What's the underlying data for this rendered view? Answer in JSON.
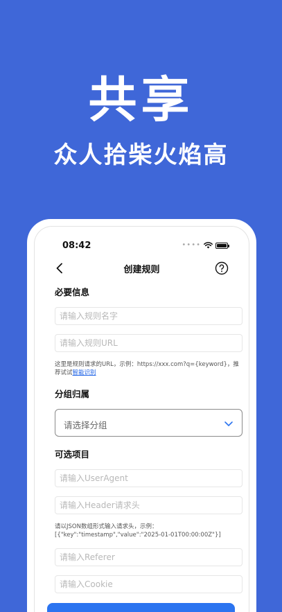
{
  "hero": {
    "title": "共享",
    "subtitle": "众人拾柴火焰高"
  },
  "status_bar": {
    "time": "08:42"
  },
  "nav": {
    "title": "创建规则",
    "back_icon": "chevron-left-icon",
    "help_icon": "question-circle-icon"
  },
  "required_section": {
    "title": "必要信息",
    "name_placeholder": "请输入规则名字",
    "url_placeholder": "请输入规则URL",
    "hint_text": "这里是规则请求的URL，示例：https://xxx.com?q={keyword}，推荐试试",
    "hint_link": "智能识别"
  },
  "group_section": {
    "title": "分组归属",
    "select_placeholder": "请选择分组"
  },
  "optional_section": {
    "title": "可选项目",
    "useragent_placeholder": "请输入UserAgent",
    "header_placeholder": "请输入Header请求头",
    "header_hint": "请以JSON数组形式输入请求头，示例：[{\"key\":\"timestamp\",\"value\":\"2025-01-01T00:00:00Z\"}]",
    "referer_placeholder": "请输入Referer",
    "cookie_placeholder": "请输入Cookie"
  },
  "colors": {
    "background": "#3f67d8",
    "accent": "#2b74f0",
    "link": "#1f63e6"
  }
}
